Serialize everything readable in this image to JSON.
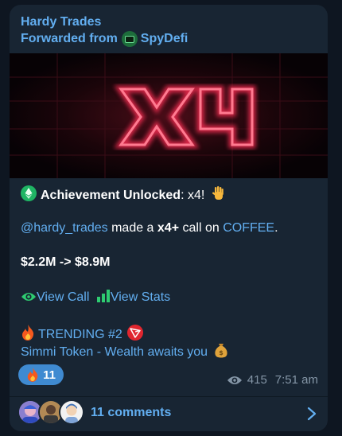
{
  "message": {
    "channel_name": "Hardy Trades",
    "forwarded_prefix": "Forwarded from",
    "forwarded_source": "SpyDefi",
    "media_text": "x4",
    "achievement_label": "Achievement Unlocked",
    "achievement_value": ": x4!",
    "mention": "@hardy_trades",
    "call_text_1": " made a ",
    "call_multiplier": "x4+",
    "call_text_2": " call on ",
    "token_link": "COFFEE",
    "call_text_end": ".",
    "price_range": "$2.2M -> $8.9M",
    "view_call": "View Call",
    "view_stats": "View Stats",
    "trending_label": "TRENDING #2",
    "ad_link": "Simmi Token - Wealth awaits you",
    "reaction_count": "11",
    "view_count": "415",
    "time": "7:51 am",
    "comments_label": "11 comments"
  },
  "icons": {
    "achievement": "ethereum-icon",
    "wave": "waving-hand-icon",
    "eye": "eye-icon",
    "stats": "bar-chart-icon",
    "fire": "fire-icon",
    "tron": "tron-icon",
    "money": "money-bag-icon",
    "chevron": "chevron-right-icon"
  },
  "colors": {
    "background": "#0e1621",
    "bubble": "#182533",
    "link": "#62aef0",
    "reaction": "#3f8ad1",
    "meta": "#8495a6",
    "neon": "#ff3c62"
  }
}
